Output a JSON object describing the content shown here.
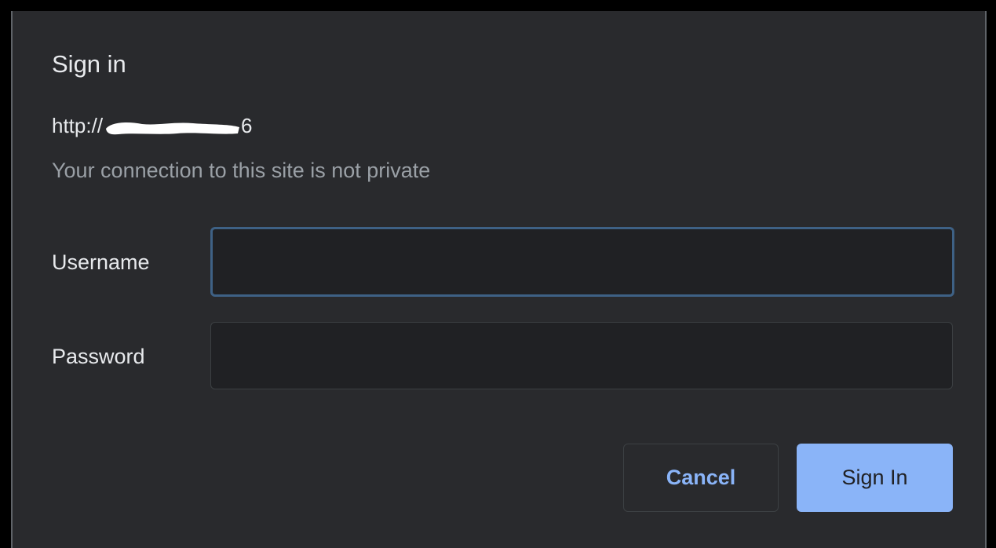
{
  "dialog": {
    "title": "Sign in",
    "origin_prefix": "http://",
    "origin_suffix": "6",
    "notice": "Your connection to this site is not private"
  },
  "form": {
    "username_label": "Username",
    "username_value": "",
    "password_label": "Password",
    "password_value": ""
  },
  "buttons": {
    "cancel_label": "Cancel",
    "signin_label": "Sign In"
  },
  "colors": {
    "background": "#292a2d",
    "accent": "#8ab4f8",
    "focus_border": "#3e6185",
    "muted_text": "#9aa0a6"
  }
}
